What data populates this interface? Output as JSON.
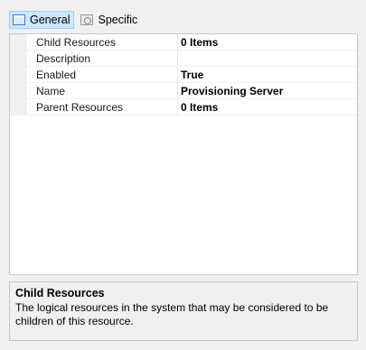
{
  "tabs": [
    {
      "label": "General",
      "icon": "general-icon",
      "active": true
    },
    {
      "label": "Specific",
      "icon": "specific-icon",
      "active": false
    }
  ],
  "properties": [
    {
      "name": "Child Resources",
      "value": "0 Items"
    },
    {
      "name": "Description",
      "value": ""
    },
    {
      "name": "Enabled",
      "value": "True"
    },
    {
      "name": "Name",
      "value": "Provisioning Server"
    },
    {
      "name": "Parent Resources",
      "value": "0 Items"
    }
  ],
  "help": {
    "title": "Child Resources",
    "description": "The logical resources in the system that may be considered to be children of this resource."
  },
  "colors": {
    "active_tab_bg": "#cce8ff",
    "active_tab_border": "#99d1ff",
    "panel_bg": "#f0f0f0",
    "grid_bg": "#ffffff"
  }
}
